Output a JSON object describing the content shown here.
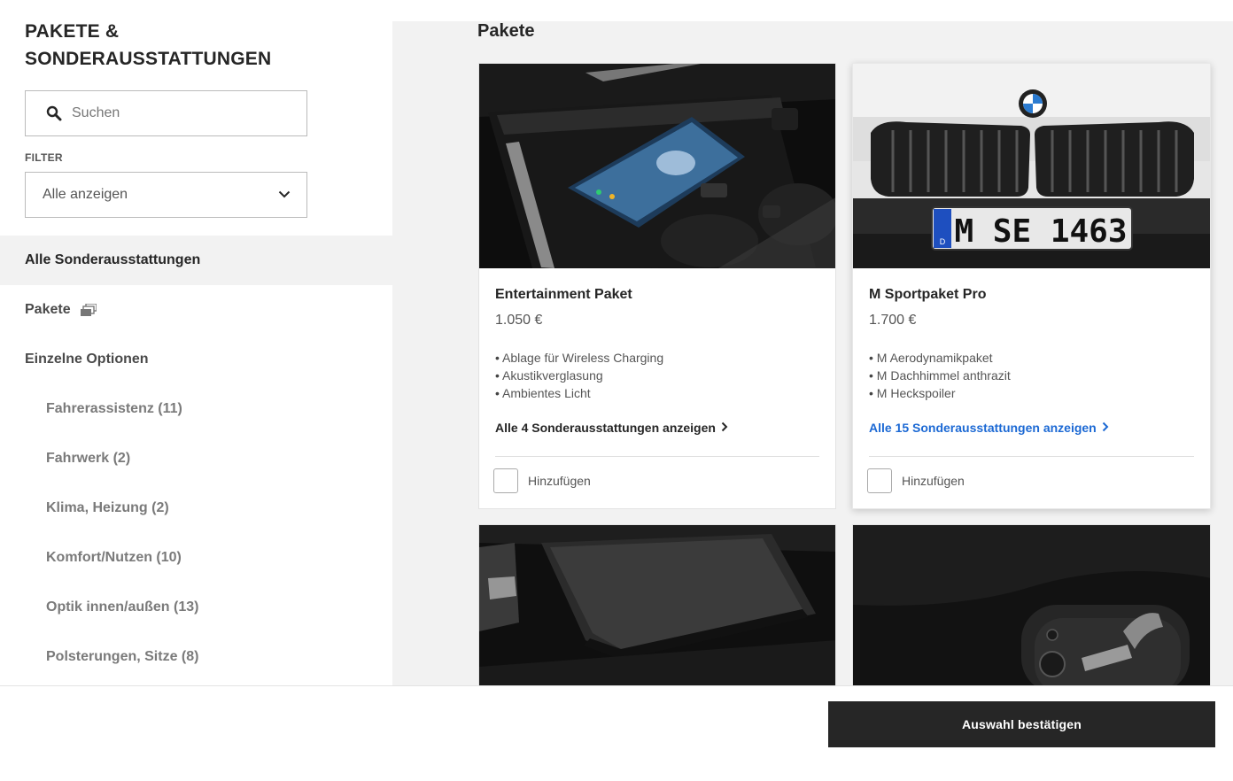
{
  "sidebar": {
    "title_line1": "PAKETE &",
    "title_line2": "SONDERAUSSTATTUNGEN",
    "search": {
      "placeholder": "Suchen",
      "icon": "search-icon"
    },
    "filter": {
      "label": "FILTER",
      "selected": "Alle anzeigen"
    },
    "nav": [
      {
        "label": "Alle Sonderausstattungen",
        "active": true
      },
      {
        "label": "Pakete",
        "icon": "stacked-cards-icon"
      },
      {
        "label": "Einzelne Optionen"
      }
    ],
    "subnav": [
      {
        "label": "Fahrerassistenz (11)"
      },
      {
        "label": "Fahrwerk (2)"
      },
      {
        "label": "Klima, Heizung (2)"
      },
      {
        "label": "Komfort/Nutzen (10)"
      },
      {
        "label": "Optik innen/außen (13)"
      },
      {
        "label": "Polsterungen, Sitze (8)"
      }
    ]
  },
  "main": {
    "section_title": "Pakete",
    "cards": [
      {
        "title": "Entertainment Paket",
        "price": "1.050 €",
        "features": [
          "Ablage für Wireless Charging",
          "Akustikverglasung",
          "Ambientes Licht"
        ],
        "link": "Alle 4 Sonderausstattungen anzeigen",
        "checkbox_label": "Hinzufügen",
        "checked": false
      },
      {
        "title": "M Sportpaket Pro",
        "price": "1.700 €",
        "features": [
          "M Aerodynamikpaket",
          "M Dachhimmel anthrazit",
          "M Heckspoiler"
        ],
        "link": "Alle 15 Sonderausstattungen anzeigen",
        "checkbox_label": "Hinzufügen",
        "checked": false,
        "plate": "M SE 1463",
        "plate_country": "D"
      }
    ]
  },
  "footer": {
    "confirm_label": "Auswahl bestätigen"
  },
  "colors": {
    "accent_blue": "#1c69d4",
    "dark": "#262626",
    "panel": "#f2f2f2"
  }
}
